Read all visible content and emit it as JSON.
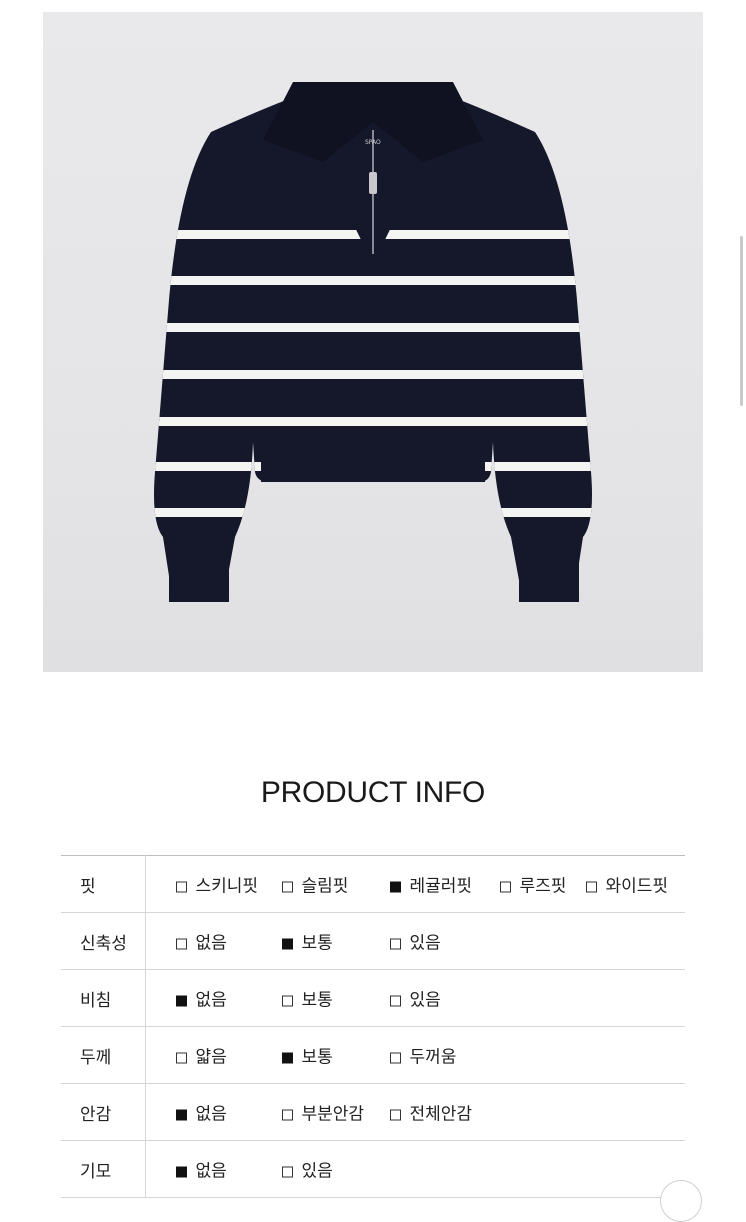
{
  "product_image": {
    "brand_tag": "SPAO"
  },
  "section_title": "PRODUCT INFO",
  "rows": [
    {
      "label": "핏",
      "options": [
        {
          "text": "스키니핏",
          "checked": false
        },
        {
          "text": "슬림핏",
          "checked": false
        },
        {
          "text": "레귤러핏",
          "checked": true
        },
        {
          "text": "루즈핏",
          "checked": false
        },
        {
          "text": "와이드핏",
          "checked": false
        }
      ]
    },
    {
      "label": "신축성",
      "options": [
        {
          "text": "없음",
          "checked": false
        },
        {
          "text": "보통",
          "checked": true
        },
        {
          "text": "있음",
          "checked": false
        }
      ]
    },
    {
      "label": "비침",
      "options": [
        {
          "text": "없음",
          "checked": true
        },
        {
          "text": "보통",
          "checked": false
        },
        {
          "text": "있음",
          "checked": false
        }
      ]
    },
    {
      "label": "두께",
      "options": [
        {
          "text": "얇음",
          "checked": false
        },
        {
          "text": "보통",
          "checked": true
        },
        {
          "text": "두꺼움",
          "checked": false
        }
      ]
    },
    {
      "label": "안감",
      "options": [
        {
          "text": "없음",
          "checked": true
        },
        {
          "text": "부분안감",
          "checked": false
        },
        {
          "text": "전체안감",
          "checked": false
        }
      ]
    },
    {
      "label": "기모",
      "options": [
        {
          "text": "없음",
          "checked": true
        },
        {
          "text": "있음",
          "checked": false
        }
      ]
    }
  ],
  "colors": {
    "sweater": "#15172a",
    "stripe": "#f4f4f2",
    "checked": "#111111"
  }
}
